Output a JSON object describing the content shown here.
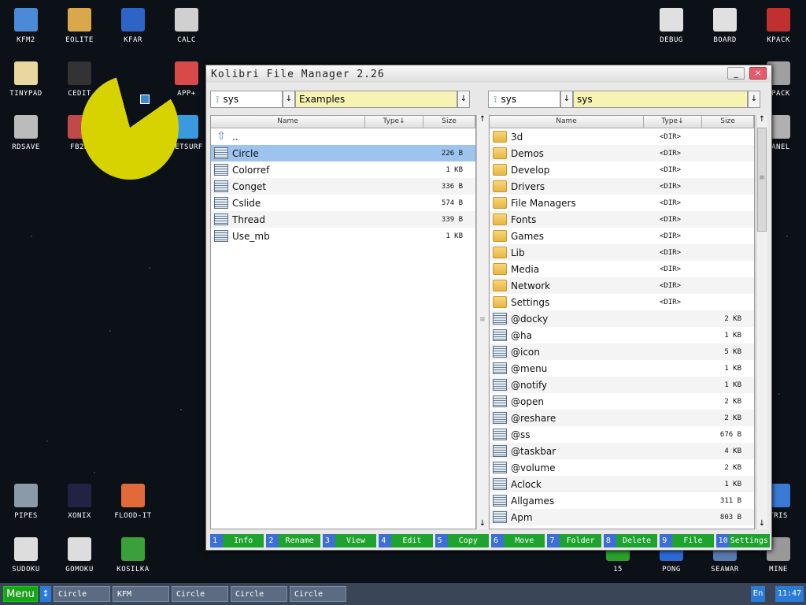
{
  "desktop_icons": [
    {
      "label": "KFM2",
      "color": "#4a8ad6"
    },
    {
      "label": "EOLITE",
      "color": "#d8a84a"
    },
    {
      "label": "KFAR",
      "color": "#2f64c7"
    },
    {
      "label": "CALC",
      "color": "#d0d0d0"
    },
    {
      "label": "TINYPAD",
      "color": "#e8d8a0"
    },
    {
      "label": "CEDIT",
      "color": "#333333"
    },
    {
      "label": "APP+",
      "color": "#d84a4a"
    },
    {
      "label": "RDSAVE",
      "color": "#bbbbbb"
    },
    {
      "label": "FB2R",
      "color": "#c04a4a"
    },
    {
      "label": "NETSURF",
      "color": "#3a9ae0"
    },
    {
      "label": "DEBUG",
      "color": "#e0e0e0"
    },
    {
      "label": "BOARD",
      "color": "#e0e0e0"
    },
    {
      "label": "KPACK",
      "color": "#c03030"
    },
    {
      "label": "CPACK",
      "color": "#a0a0a0"
    },
    {
      "label": "PANEL",
      "color": "#b0b0b0"
    },
    {
      "label": "PIPES",
      "color": "#8a9aa8"
    },
    {
      "label": "XONIX",
      "color": "#222244"
    },
    {
      "label": "FLOOD-IT",
      "color": "#e06a3a"
    },
    {
      "label": "SUDOKU",
      "color": "#dddddd"
    },
    {
      "label": "GOMOKU",
      "color": "#dddddd"
    },
    {
      "label": "KOSILKA",
      "color": "#3aa03a"
    },
    {
      "label": "15",
      "color": "#2aa02a"
    },
    {
      "label": "PONG",
      "color": "#2a6ad6"
    },
    {
      "label": "SEAWAR",
      "color": "#5a7ab0"
    },
    {
      "label": "MINE",
      "color": "#999999"
    },
    {
      "label": "TRIS",
      "color": "#3a7ad6"
    }
  ],
  "window": {
    "title": "Kolibri File Manager 2.26",
    "minimize": "_",
    "close": "×"
  },
  "left": {
    "drive": "sys",
    "path": "Examples",
    "columns": {
      "name": "Name",
      "type": "Type↓",
      "size": "Size"
    },
    "rows": [
      {
        "name": "..",
        "type": "",
        "size": "",
        "icon": "up"
      },
      {
        "name": "Circle",
        "type": "",
        "size": "226 B",
        "icon": "file",
        "selected": true
      },
      {
        "name": "Colorref",
        "type": "",
        "size": "1 KB",
        "icon": "file"
      },
      {
        "name": "Conget",
        "type": "",
        "size": "336 B",
        "icon": "file"
      },
      {
        "name": "Cslide",
        "type": "",
        "size": "574 B",
        "icon": "file"
      },
      {
        "name": "Thread",
        "type": "",
        "size": "339 B",
        "icon": "file"
      },
      {
        "name": "Use_mb",
        "type": "",
        "size": "1 KB",
        "icon": "file"
      }
    ]
  },
  "right": {
    "drive": "sys",
    "path": "sys",
    "columns": {
      "name": "Name",
      "type": "Type↓",
      "size": "Size"
    },
    "rows": [
      {
        "name": "3d",
        "type": "<DIR>",
        "size": "",
        "icon": "folder"
      },
      {
        "name": "Demos",
        "type": "<DIR>",
        "size": "",
        "icon": "folder"
      },
      {
        "name": "Develop",
        "type": "<DIR>",
        "size": "",
        "icon": "folder"
      },
      {
        "name": "Drivers",
        "type": "<DIR>",
        "size": "",
        "icon": "folder"
      },
      {
        "name": "File Managers",
        "type": "<DIR>",
        "size": "",
        "icon": "folder"
      },
      {
        "name": "Fonts",
        "type": "<DIR>",
        "size": "",
        "icon": "folder"
      },
      {
        "name": "Games",
        "type": "<DIR>",
        "size": "",
        "icon": "folder"
      },
      {
        "name": "Lib",
        "type": "<DIR>",
        "size": "",
        "icon": "folder"
      },
      {
        "name": "Media",
        "type": "<DIR>",
        "size": "",
        "icon": "folder"
      },
      {
        "name": "Network",
        "type": "<DIR>",
        "size": "",
        "icon": "folder"
      },
      {
        "name": "Settings",
        "type": "<DIR>",
        "size": "",
        "icon": "folder"
      },
      {
        "name": "@docky",
        "type": "",
        "size": "2 KB",
        "icon": "file"
      },
      {
        "name": "@ha",
        "type": "",
        "size": "1 KB",
        "icon": "file"
      },
      {
        "name": "@icon",
        "type": "",
        "size": "5 KB",
        "icon": "file"
      },
      {
        "name": "@menu",
        "type": "",
        "size": "1 KB",
        "icon": "file"
      },
      {
        "name": "@notify",
        "type": "",
        "size": "1 KB",
        "icon": "file"
      },
      {
        "name": "@open",
        "type": "",
        "size": "2 KB",
        "icon": "file"
      },
      {
        "name": "@reshare",
        "type": "",
        "size": "2 KB",
        "icon": "file"
      },
      {
        "name": "@ss",
        "type": "",
        "size": "676 B",
        "icon": "file"
      },
      {
        "name": "@taskbar",
        "type": "",
        "size": "4 KB",
        "icon": "file"
      },
      {
        "name": "@volume",
        "type": "",
        "size": "2 KB",
        "icon": "file"
      },
      {
        "name": "Aclock",
        "type": "",
        "size": "1 KB",
        "icon": "file"
      },
      {
        "name": "Allgames",
        "type": "",
        "size": "311 B",
        "icon": "file"
      },
      {
        "name": "Apm",
        "type": "",
        "size": "803 B",
        "icon": "file"
      }
    ]
  },
  "fkeys": [
    {
      "n": "1",
      "label": "Info"
    },
    {
      "n": "2",
      "label": "Rename"
    },
    {
      "n": "3",
      "label": "View"
    },
    {
      "n": "4",
      "label": "Edit"
    },
    {
      "n": "5",
      "label": "Copy"
    },
    {
      "n": "6",
      "label": "Move"
    },
    {
      "n": "7",
      "label": "Folder"
    },
    {
      "n": "8",
      "label": "Delete"
    },
    {
      "n": "9",
      "label": "File"
    },
    {
      "n": "10",
      "label": "Settings"
    }
  ],
  "taskbar": {
    "menu": "Menu",
    "arrows": "↕",
    "tasks": [
      "Circle",
      "KFM",
      "Circle",
      "Circle",
      "Circle"
    ],
    "lang": "En",
    "clock": "11:47"
  }
}
